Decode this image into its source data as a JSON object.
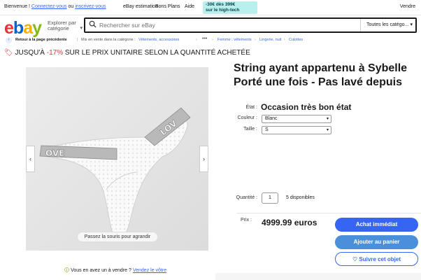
{
  "topbar": {
    "greeting_prefix": "Bienvenue ! ",
    "login_link": "Connectez-vous",
    "or_text": " ou ",
    "register_link": "inscrivez-vous",
    "links": [
      "eBay estimation",
      "Bons Plans",
      "Aide"
    ],
    "promo_line1": "-30€ dès 399€",
    "promo_line2": "sur le high-tech",
    "sell": "Vendre"
  },
  "header": {
    "logo": [
      "e",
      "b",
      "a",
      "y"
    ],
    "shop_by": "Explorer par catégorie",
    "search_placeholder": "Rechercher sur eBay",
    "category_select": "Toutes les catégo..."
  },
  "breadcrumb": {
    "back": "Retour à la page précédente",
    "listed_in": "Mis en vente dans la catégorie :",
    "items": [
      "Vêtements, accessoires",
      "Femme : vêtements",
      "Lingerie, nuit",
      "Culottes"
    ]
  },
  "promo_banner": {
    "prefix": "JUSQU'À ",
    "percent": "-17%",
    "suffix": " SUR LE PRIX UNITAIRE SELON LA QUANTITÉ ACHETÉE"
  },
  "product_image": {
    "band_text_left": "OVE",
    "band_text_right": "LOV",
    "zoom_hint": "Passez la souris pour agrandir"
  },
  "item": {
    "title": "String ayant appartenu à Sybelle Porté une fois - Pas lavé depuis",
    "condition_label": "État :",
    "condition_value": "Occasion très bon état",
    "color_label": "Couleur :",
    "color_value": "Blanc",
    "size_label": "Taille :",
    "size_value": "S",
    "quantity_label": "Quantité :",
    "quantity_value": "1",
    "available": "5 disponibles",
    "price_label": "Prix :",
    "price_value": "4999.99 euros"
  },
  "actions": {
    "buy_now": "Achat immédiat",
    "add_to_cart": "Ajouter au panier",
    "watch": "Suivre cet objet"
  },
  "sell_prompt": {
    "question": "Vous en avez un à vendre ?",
    "link": "Vendez le vôtre"
  }
}
